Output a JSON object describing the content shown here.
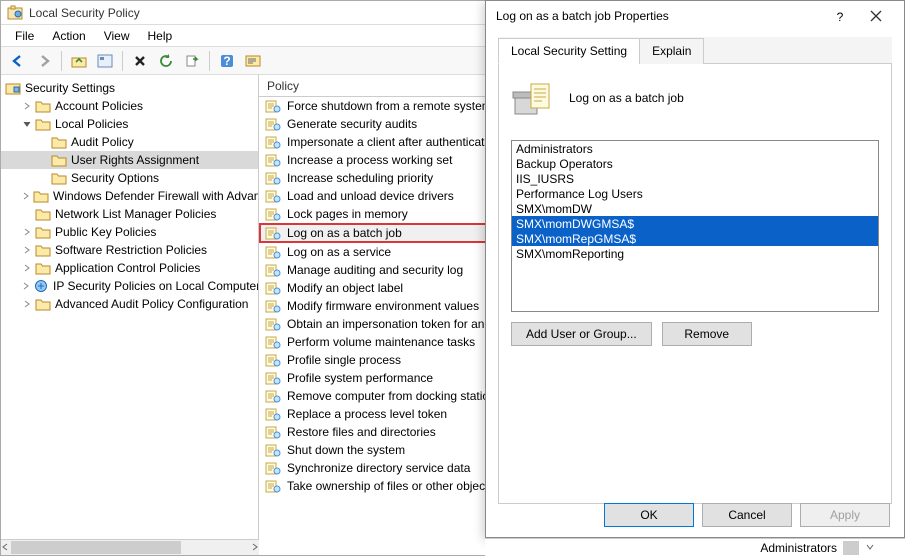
{
  "window": {
    "title": "Local Security Policy"
  },
  "menubar": [
    "File",
    "Action",
    "View",
    "Help"
  ],
  "toolbar_icons": [
    "back",
    "forward",
    "up",
    "show-hide",
    "delete",
    "refresh",
    "export",
    "help",
    "word-wrap"
  ],
  "tree": {
    "root": "Security Settings",
    "nodes": [
      {
        "label": "Account Policies",
        "expanded": false,
        "depth": 1
      },
      {
        "label": "Local Policies",
        "expanded": true,
        "depth": 1,
        "children": [
          {
            "label": "Audit Policy",
            "depth": 2
          },
          {
            "label": "User Rights Assignment",
            "depth": 2,
            "selected": true
          },
          {
            "label": "Security Options",
            "depth": 2
          }
        ]
      },
      {
        "label": "Windows Defender Firewall with Advan",
        "expanded": false,
        "depth": 1
      },
      {
        "label": "Network List Manager Policies",
        "expanded": false,
        "depth": 1,
        "no_expander": true
      },
      {
        "label": "Public Key Policies",
        "expanded": false,
        "depth": 1
      },
      {
        "label": "Software Restriction Policies",
        "expanded": false,
        "depth": 1
      },
      {
        "label": "Application Control Policies",
        "expanded": false,
        "depth": 1
      },
      {
        "label": "IP Security Policies on Local Computer",
        "expanded": false,
        "depth": 1,
        "alt_icon": true
      },
      {
        "label": "Advanced Audit Policy Configuration",
        "expanded": false,
        "depth": 1
      }
    ]
  },
  "list": {
    "header": "Policy",
    "items": [
      "Force shutdown from a remote system",
      "Generate security audits",
      "Impersonate a client after authentication",
      "Increase a process working set",
      "Increase scheduling priority",
      "Load and unload device drivers",
      "Lock pages in memory",
      "Log on as a batch job",
      "Log on as a service",
      "Manage auditing and security log",
      "Modify an object label",
      "Modify firmware environment values",
      "Obtain an impersonation token for an",
      "Perform volume maintenance tasks",
      "Profile single process",
      "Profile system performance",
      "Remove computer from docking station",
      "Replace a process level token",
      "Restore files and directories",
      "Shut down the system",
      "Synchronize directory service data",
      "Take ownership of files or other objects"
    ],
    "highlighted_index": 7
  },
  "dialog": {
    "title": "Log on as a batch job Properties",
    "tabs": [
      "Local Security Setting",
      "Explain"
    ],
    "active_tab": 0,
    "policy_name": "Log on as a batch job",
    "users": [
      {
        "name": "Administrators",
        "selected": false
      },
      {
        "name": "Backup Operators",
        "selected": false
      },
      {
        "name": "IIS_IUSRS",
        "selected": false
      },
      {
        "name": "Performance Log Users",
        "selected": false
      },
      {
        "name": "SMX\\momDW",
        "selected": false
      },
      {
        "name": "SMX\\momDWGMSA$",
        "selected": true
      },
      {
        "name": "SMX\\momRepGMSA$",
        "selected": true
      },
      {
        "name": "SMX\\momReporting",
        "selected": false
      }
    ],
    "buttons": {
      "add": "Add User or Group...",
      "remove": "Remove",
      "ok": "OK",
      "cancel": "Cancel",
      "apply": "Apply"
    }
  },
  "detail_strip": "Administrators"
}
